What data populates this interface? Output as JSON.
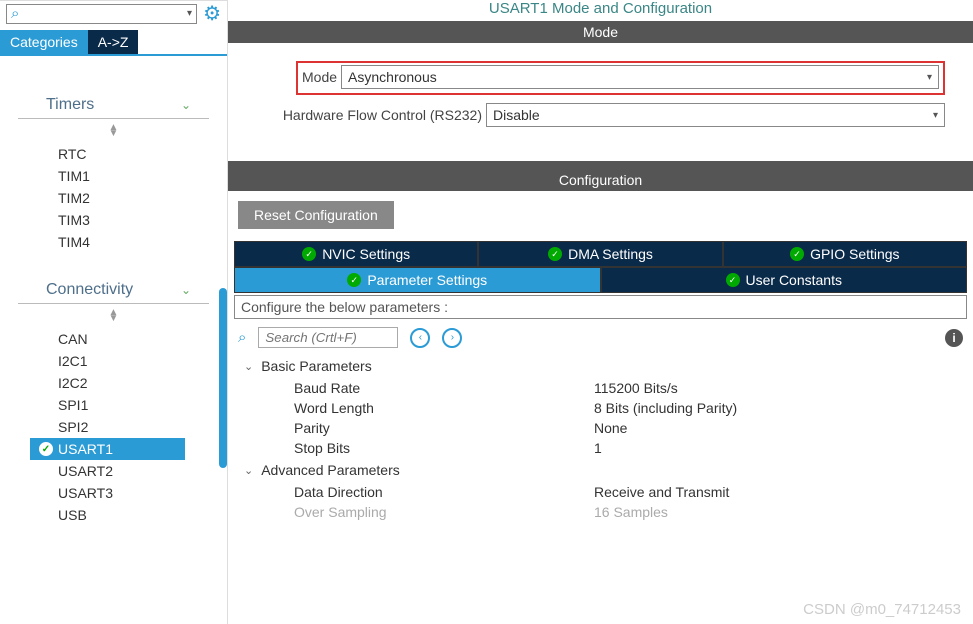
{
  "search": {
    "placeholder": ""
  },
  "left_tabs": {
    "categories": "Categories",
    "az": "A->Z"
  },
  "sidebar": {
    "groups": [
      {
        "name": "Timers",
        "items": [
          "RTC",
          "TIM1",
          "TIM2",
          "TIM3",
          "TIM4"
        ]
      },
      {
        "name": "Connectivity",
        "items": [
          "CAN",
          "I2C1",
          "I2C2",
          "SPI1",
          "SPI2",
          "USART1",
          "USART2",
          "USART3",
          "USB"
        ],
        "selected": "USART1",
        "checked": "USART1"
      }
    ]
  },
  "title": "USART1 Mode and Configuration",
  "mode_header": "Mode",
  "mode": {
    "label": "Mode",
    "value": "Asynchronous",
    "hwfc_label": "Hardware Flow Control (RS232)",
    "hwfc_value": "Disable"
  },
  "config_header": "Configuration",
  "reset_label": "Reset Configuration",
  "config_tabs_top": [
    "NVIC Settings",
    "DMA Settings",
    "GPIO Settings"
  ],
  "config_tabs_bottom": [
    "Parameter Settings",
    "User Constants"
  ],
  "param_note": "Configure the below parameters :",
  "param_search_placeholder": "Search (Crtl+F)",
  "param_groups": [
    {
      "name": "Basic Parameters",
      "rows": [
        {
          "name": "Baud Rate",
          "value": "115200 Bits/s"
        },
        {
          "name": "Word Length",
          "value": "8 Bits (including Parity)"
        },
        {
          "name": "Parity",
          "value": "None"
        },
        {
          "name": "Stop Bits",
          "value": "1"
        }
      ]
    },
    {
      "name": "Advanced Parameters",
      "rows": [
        {
          "name": "Data Direction",
          "value": "Receive and Transmit"
        },
        {
          "name": "Over Sampling",
          "value": "16 Samples",
          "disabled": true
        }
      ]
    }
  ],
  "watermark": "CSDN @m0_74712453"
}
